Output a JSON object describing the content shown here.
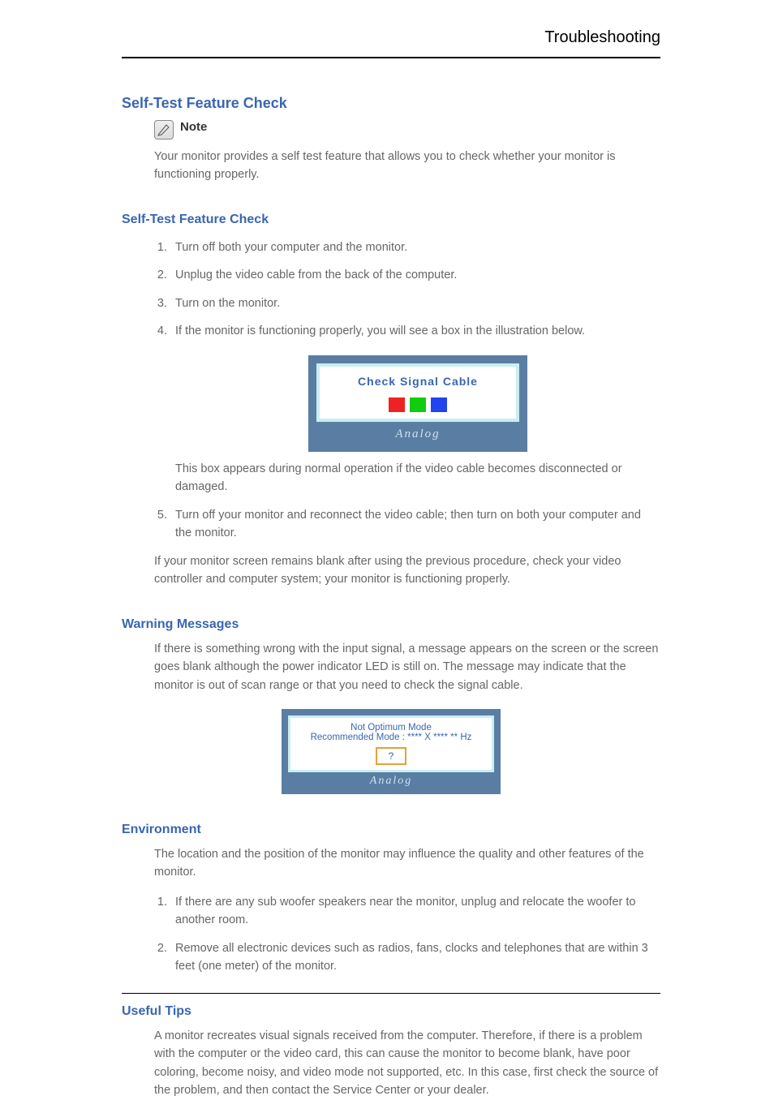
{
  "header": {
    "title": "Troubleshooting"
  },
  "sections": {
    "selfTest": {
      "heading": "Self-Test Feature Check",
      "noteLabel": "Note",
      "noteText": "Your monitor provides a self test feature that allows you to check whether your monitor is functioning properly.",
      "sub1Heading": "Self-Test Feature Check",
      "steps": [
        "Turn off both your computer and the monitor.",
        "Unplug the video cable from the back of the computer.",
        "Turn on the monitor.",
        "If the monitor is functioning properly, you will see a box in the illustration below."
      ],
      "osd1": {
        "title": "Check Signal Cable",
        "bottom": "Analog"
      },
      "afterOsd1a": "This box appears during normal operation if the video cable becomes disconnected or damaged.",
      "step5": "Turn off your monitor and reconnect the video cable; then turn on both your computer and the monitor.",
      "afterSteps": "If your monitor screen remains blank after using the previous procedure, check your video controller and computer system; your monitor is functioning properly.",
      "sub2Heading": "Warning Messages",
      "sub2Para": "If there is something wrong with the input signal, a message appears on the screen or the screen goes blank although the power indicator LED is still on. The message may indicate that the monitor is out of scan range or that you need to check the signal cable.",
      "osd2": {
        "line1": "Not Optimum Mode",
        "line2": "Recommended Mode : **** X **** ** Hz",
        "q": "?",
        "bottom": "Analog"
      },
      "sub3Heading": "Environment",
      "sub3Para": "The location and the position of the monitor may influence the quality and other features of the monitor.",
      "envBullets": [
        "If there are any sub woofer speakers near the monitor, unplug and relocate the woofer to another room.",
        "Remove all electronic devices such as radios, fans, clocks and telephones that are within 3 feet (one meter) of the monitor."
      ],
      "sub4Heading": "Useful Tips",
      "tipA": "A monitor recreates visual signals received from the computer. Therefore, if there is a problem with the computer or the video card, this can cause the monitor to become blank, have poor coloring, become noisy, and video mode not supported, etc. In this case, first check the source of the problem, and then contact the Service Center or your dealer."
    }
  }
}
